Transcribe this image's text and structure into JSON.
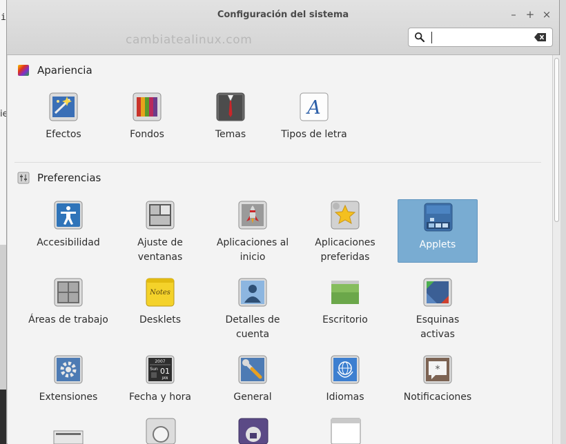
{
  "background": {
    "terminal_fragment": "i",
    "side_fragment": "ie"
  },
  "window": {
    "title": "Configuración del sistema",
    "controls": {
      "minimize": "–",
      "maximize": "+",
      "close": "×"
    },
    "watermark": "cambiatealinux.com",
    "search": {
      "value": "",
      "placeholder": ""
    }
  },
  "sections": [
    {
      "title": "Apariencia",
      "icon": "appearance-icon",
      "items": [
        {
          "label": "Efectos",
          "icon": "effects-icon"
        },
        {
          "label": "Fondos",
          "icon": "backgrounds-icon"
        },
        {
          "label": "Temas",
          "icon": "themes-icon"
        },
        {
          "label": "Tipos de letra",
          "icon": "fonts-icon"
        }
      ]
    },
    {
      "title": "Preferencias",
      "icon": "preferences-icon",
      "items": [
        {
          "label": "Accesibilidad",
          "icon": "accessibility-icon"
        },
        {
          "label": "Ajuste de ventanas",
          "icon": "window-tiling-icon"
        },
        {
          "label": "Aplicaciones al inicio",
          "icon": "startup-apps-icon"
        },
        {
          "label": "Aplicaciones preferidas",
          "icon": "preferred-apps-icon"
        },
        {
          "label": "Applets",
          "icon": "applets-icon",
          "selected": true
        },
        {
          "label": "Áreas de trabajo",
          "icon": "workspaces-icon"
        },
        {
          "label": "Desklets",
          "icon": "desklets-icon"
        },
        {
          "label": "Detalles de cuenta",
          "icon": "account-details-icon"
        },
        {
          "label": "Escritorio",
          "icon": "desktop-icon"
        },
        {
          "label": "Esquinas activas",
          "icon": "hot-corners-icon"
        },
        {
          "label": "Extensiones",
          "icon": "extensions-icon"
        },
        {
          "label": "Fecha y hora",
          "icon": "date-time-icon",
          "calendar": {
            "year": "2007",
            "weekday": "Sun",
            "day": "01",
            "month": "JAN"
          }
        },
        {
          "label": "General",
          "icon": "general-icon"
        },
        {
          "label": "Idiomas",
          "icon": "languages-icon"
        },
        {
          "label": "Notificaciones",
          "icon": "notifications-icon"
        }
      ]
    }
  ],
  "colors": {
    "selection": "#79acd2",
    "window_bg": "#f3f3f3",
    "titlebar": "#d9d9d9"
  }
}
